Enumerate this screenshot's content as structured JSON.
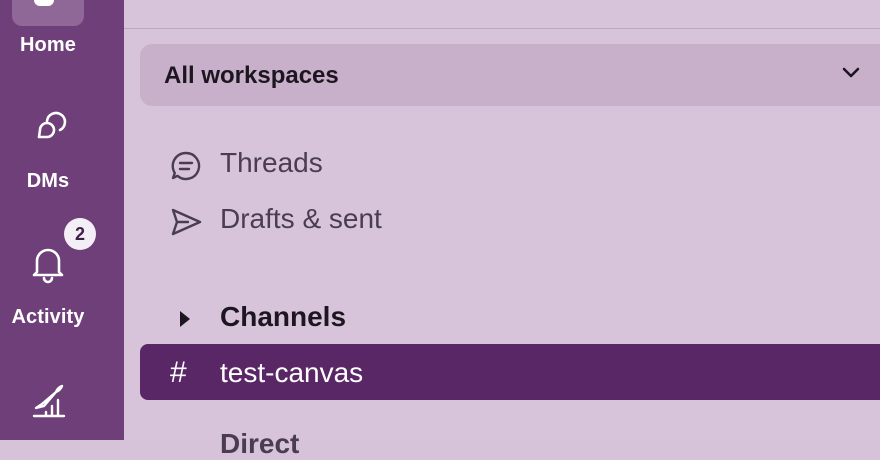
{
  "rail": {
    "home_label": "Home",
    "dms_label": "DMs",
    "activity_label": "Activity",
    "activity_badge": "2"
  },
  "sidebar": {
    "workspace_switcher": "All workspaces",
    "nav": [
      {
        "label": "Threads",
        "icon": "threads-icon"
      },
      {
        "label": "Drafts & sent",
        "icon": "send-icon"
      }
    ],
    "sections": [
      {
        "label": "Channels",
        "icon": "caret-right-icon"
      }
    ],
    "channels": [
      {
        "label": "test-canvas",
        "selected": true
      }
    ],
    "next_section_peek": "Direct"
  },
  "colors": {
    "rail": "#6e3f78",
    "sidebar": "#d7c4da",
    "switcher": "#c8b0cb",
    "selected_channel": "#5a2766"
  }
}
